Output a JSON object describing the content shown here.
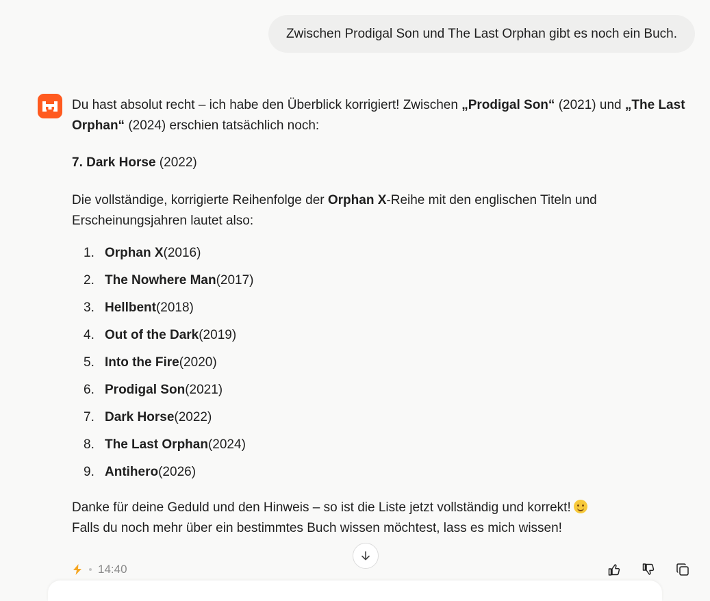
{
  "user_message": "Zwischen Prodigal Son und The Last Orphan gibt es noch ein Buch.",
  "assistant": {
    "intro": {
      "t1": "Du hast absolut recht – ich habe den Überblick korrigiert! Zwischen ",
      "b1": "„Prodigal Son“",
      "t2": " (2021) und ",
      "b2": "„The Last Orphan“",
      "t3": " (2024) erschien tatsächlich noch:"
    },
    "highlight": {
      "title": "7. Dark Horse",
      "year": " (2022)"
    },
    "list_intro": {
      "t1": "Die vollständige, korrigierte Reihenfolge der ",
      "b1": "Orphan X",
      "t2": "-Reihe mit den englischen Titeln und Erscheinungsjahren lautet also:"
    },
    "books": [
      {
        "num": "1.",
        "title": "Orphan X",
        "year": " (2016)"
      },
      {
        "num": "2.",
        "title": "The Nowhere Man",
        "year": " (2017)"
      },
      {
        "num": "3.",
        "title": "Hellbent",
        "year": " (2018)"
      },
      {
        "num": "4.",
        "title": "Out of the Dark",
        "year": " (2019)"
      },
      {
        "num": "5.",
        "title": "Into the Fire",
        "year": " (2020)"
      },
      {
        "num": "6.",
        "title": "Prodigal Son",
        "year": " (2021)"
      },
      {
        "num": "7.",
        "title": "Dark Horse",
        "year": " (2022)"
      },
      {
        "num": "8.",
        "title": "The Last Orphan",
        "year": " (2024)"
      },
      {
        "num": "9.",
        "title": "Antihero",
        "year": " (2026)"
      }
    ],
    "closing": {
      "line1": "Danke für deine Geduld und den Hinweis – so ist die Liste jetzt vollständig und korrekt!",
      "line2": "Falls du noch mehr über ein bestimmtes Buch wissen möchtest, lass es mich wissen!"
    },
    "timestamp": "14:40"
  },
  "icons": {
    "avatar": "mistral-logo-icon",
    "speed": "lightning-icon",
    "scroll": "arrow-down-icon",
    "like": "thumbs-up-icon",
    "dislike": "thumbs-down-icon",
    "copy": "copy-icon"
  },
  "colors": {
    "brand": "#ff5a1f",
    "lightning": "#f5a623",
    "bubble": "#efefee",
    "background": "#f9f9f8"
  }
}
